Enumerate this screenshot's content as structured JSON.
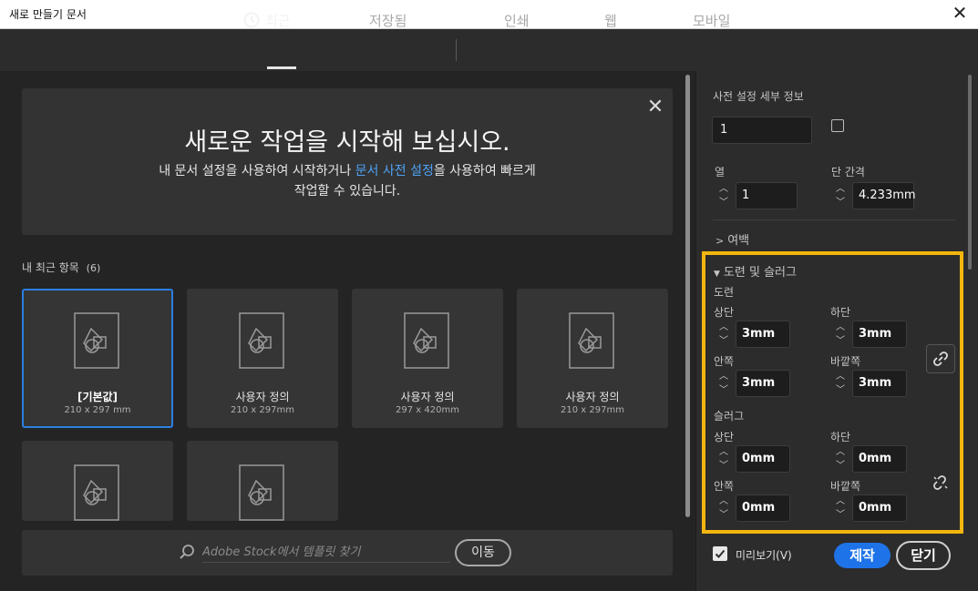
{
  "window": {
    "title": "새로 만들기 문서",
    "close_glyph": "✕"
  },
  "tabs": [
    {
      "label": "최근",
      "active": true,
      "icon": "clock-icon"
    },
    {
      "label": "저장됨",
      "active": false
    },
    {
      "label": "인쇄",
      "active": false
    },
    {
      "label": "웹",
      "active": false
    },
    {
      "label": "모바일",
      "active": false
    }
  ],
  "banner": {
    "title": "새로운 작업을 시작해 보십시오.",
    "text_before": "내 문서 설정을 사용하여 시작하거나 ",
    "link": "문서 사전 설정",
    "text_after": "을 사용하여 빠르게",
    "text_line2": "작업할 수 있습니다.",
    "close_glyph": "✕"
  },
  "recent": {
    "label": "내 최근 항목",
    "count": "(6)",
    "items": [
      {
        "name": "[기본값]",
        "size": "210 x 297 mm",
        "selected": true
      },
      {
        "name": "사용자 정의",
        "size": "210 x 297mm",
        "selected": false
      },
      {
        "name": "사용자 정의",
        "size": "297 x 420mm",
        "selected": false
      },
      {
        "name": "사용자 정의",
        "size": "210 x 297mm",
        "selected": false
      },
      {
        "name": "",
        "size": "",
        "selected": false
      },
      {
        "name": "",
        "size": "",
        "selected": false
      }
    ]
  },
  "search": {
    "placeholder": "Adobe Stock에서 템플릿 찾기",
    "go_label": "이동"
  },
  "details": {
    "preset_label": "사전 설정 세부 정보",
    "pages_value": "1",
    "columns_label": "열",
    "columns_value": "1",
    "gutter_label": "단 간격",
    "gutter_value": "4.233mm",
    "margins_label": "여백",
    "bleed_slug_label": "도련 및 슬러그",
    "bleed": {
      "label": "도련",
      "top_label": "상단",
      "top_value": "3mm",
      "bottom_label": "하단",
      "bottom_value": "3mm",
      "inside_label": "안쪽",
      "inside_value": "3mm",
      "outside_label": "바깥쪽",
      "outside_value": "3mm"
    },
    "slug": {
      "label": "슬러그",
      "top_label": "상단",
      "top_value": "0mm",
      "bottom_label": "하단",
      "bottom_value": "0mm",
      "inside_label": "안쪽",
      "inside_value": "0mm",
      "outside_label": "바깥쪽",
      "outside_value": "0mm"
    },
    "preview_label": "미리보기(V)",
    "preview_checked": true,
    "create_label": "제작",
    "close_label": "닫기"
  },
  "colors": {
    "accent": "#1f73e8",
    "highlight": "#f3b60e",
    "link": "#4ea3f5"
  }
}
